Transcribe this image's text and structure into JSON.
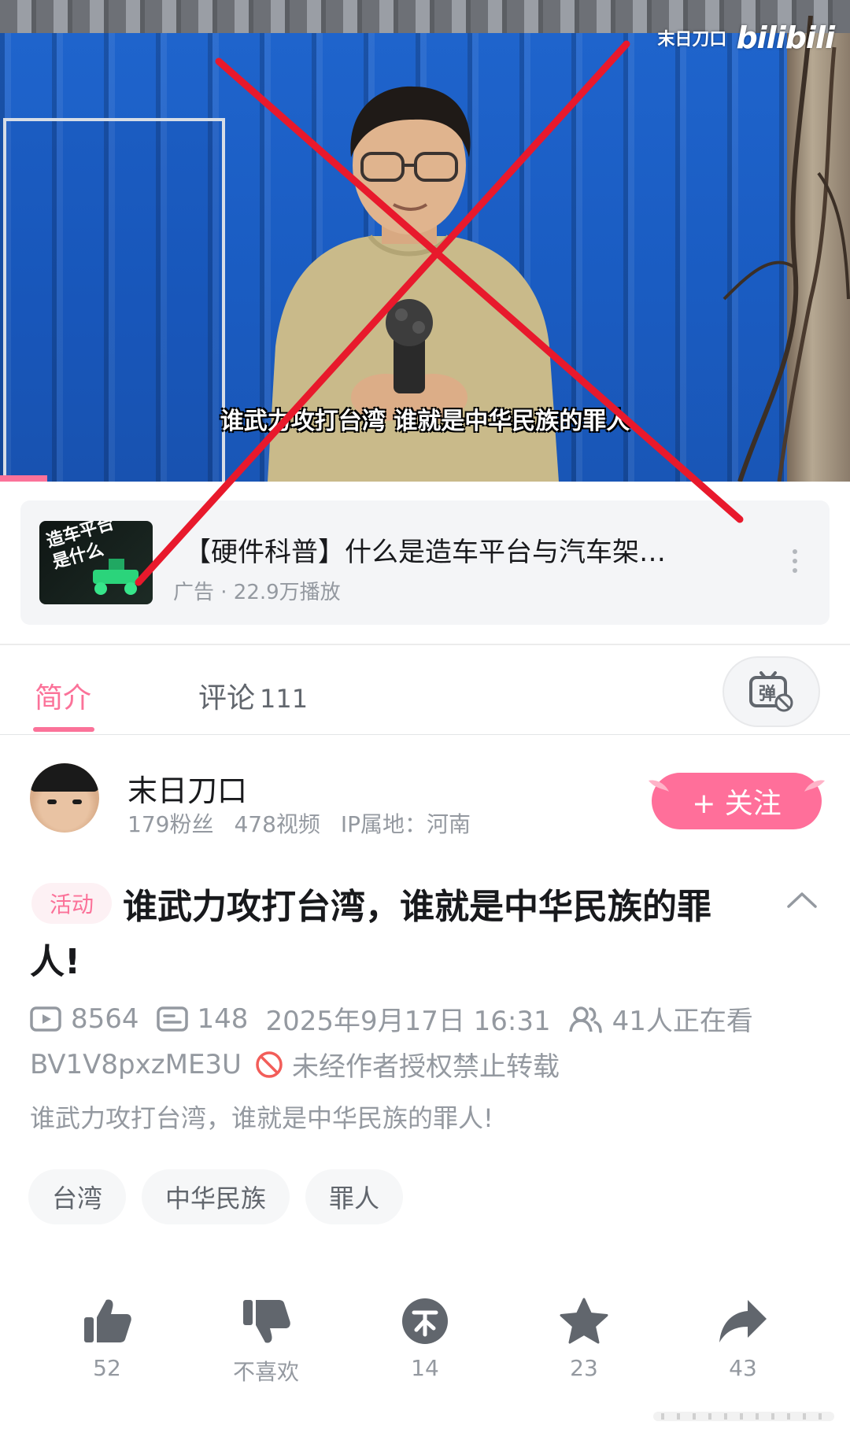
{
  "video": {
    "watermark_name": "末日刀口",
    "watermark_logo": "bilibili",
    "subtitle": "谁武力攻打台湾 谁就是中华民族的罪人"
  },
  "ad": {
    "thumb_text_line1": "造车平台",
    "thumb_text_line2": "是什么",
    "title": "【硬件科普】什么是造车平台与汽车架…",
    "meta": "广告 · 22.9万播放"
  },
  "tabs": {
    "intro": "简介",
    "comments": "评论",
    "comments_count": "111"
  },
  "uploader": {
    "name": "末日刀口",
    "fans": "179粉丝",
    "videos": "478视频",
    "ip": "IP属地：河南",
    "follow_label": "+ 关注"
  },
  "title": {
    "badge": "活动",
    "text": "谁武力攻打台湾，谁就是中华民族的罪人!"
  },
  "stats": {
    "plays": "8564",
    "danmaku": "148",
    "date": "2025年9月17日 16:31",
    "watching": "41人正在看",
    "bvid": "BV1V8pxzME3U",
    "copyright": "未经作者授权禁止转载"
  },
  "description": "谁武力攻打台湾，谁就是中华民族的罪人!",
  "tags": [
    "台湾",
    "中华民族",
    "罪人"
  ],
  "actions": {
    "like": "52",
    "dislike": "不喜欢",
    "coin": "14",
    "favorite": "23",
    "share": "43"
  },
  "colors": {
    "accent": "#fb7299",
    "follow_bg": "#ff6f9a",
    "icon_gray": "#61666d",
    "overlay_red": "#e8192c"
  },
  "icons": [
    "danmaku-toggle-icon",
    "play-count-icon",
    "danmaku-count-icon",
    "viewers-icon",
    "no-repost-icon",
    "collapse-icon",
    "like-icon",
    "dislike-icon",
    "coin-icon",
    "favorite-icon",
    "share-icon",
    "more-icon"
  ]
}
